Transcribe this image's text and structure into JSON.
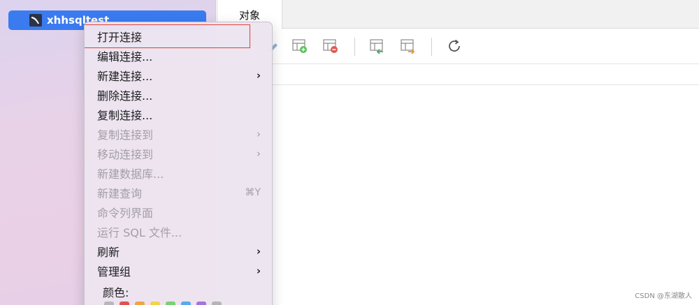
{
  "sidebar": {
    "connection_name": "xhhsqltest"
  },
  "tabs": [
    {
      "label": "对象"
    }
  ],
  "context_menu": {
    "items": [
      {
        "label": "打开连接",
        "enabled": true
      },
      {
        "label": "编辑连接...",
        "enabled": true
      },
      {
        "label": "新建连接...",
        "enabled": true,
        "submenu": true
      },
      {
        "label": "删除连接...",
        "enabled": true
      },
      {
        "label": "复制连接...",
        "enabled": true
      },
      {
        "label": "复制连接到",
        "enabled": false,
        "submenu": true
      },
      {
        "label": "移动连接到",
        "enabled": false,
        "submenu": true
      },
      {
        "label": "新建数据库...",
        "enabled": false
      },
      {
        "label": "新建查询",
        "enabled": false,
        "shortcut": "⌘Y"
      },
      {
        "label": "命令列界面",
        "enabled": false
      },
      {
        "label": "运行 SQL 文件...",
        "enabled": false
      },
      {
        "label": "刷新",
        "enabled": true,
        "submenu": true
      },
      {
        "label": "管理组",
        "enabled": true,
        "submenu": true
      }
    ],
    "submenu_arrow": "›",
    "colors_label": "颜色:",
    "color_swatches": [
      "#b8b8b8",
      "#e0524f",
      "#f0a447",
      "#f2d34b",
      "#7ccf72",
      "#5aa9ee",
      "#a374db",
      "#b5b5b5"
    ]
  },
  "watermark": "CSDN @东湖散人"
}
